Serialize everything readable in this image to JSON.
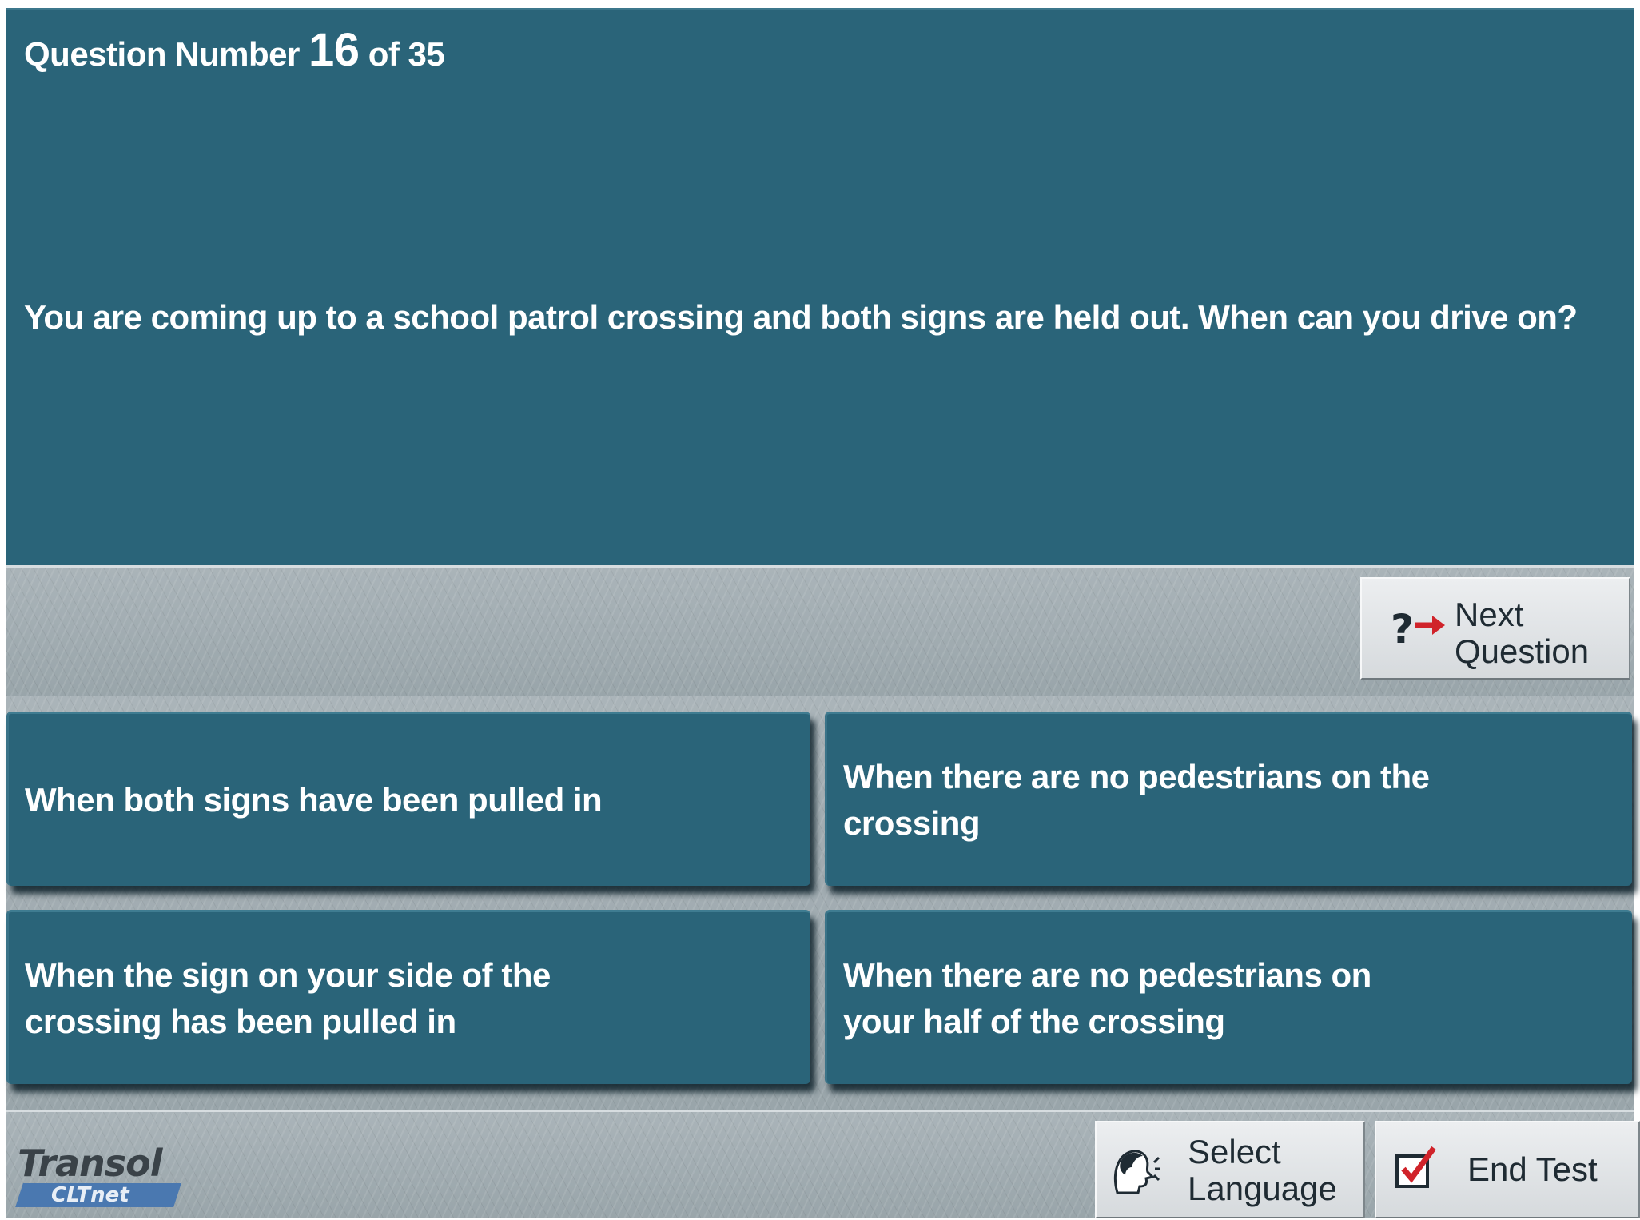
{
  "header": {
    "prefix": "Question Number",
    "current": "16",
    "suffix": "of 35"
  },
  "question": {
    "text": "You are coming up to a school patrol crossing and both signs are held out. When can you drive on?"
  },
  "next_button": {
    "line1": "Next",
    "line2": "Question",
    "icon": "question-arrow-icon"
  },
  "answers": [
    {
      "text": "When both signs have been pulled in"
    },
    {
      "line1": "When there are no pedestrians on the",
      "line2": "crossing"
    },
    {
      "line1": "When the sign on your side of the",
      "line2": "crossing has been pulled in"
    },
    {
      "line1": "When there are no pedestrians on",
      "line2": "your half of the crossing"
    }
  ],
  "footer": {
    "logo": {
      "brand": "Transol",
      "sub": "CLTnet"
    },
    "language_button": {
      "line1": "Select",
      "line2": "Language",
      "icon": "speaking-head-icon"
    },
    "end_button": {
      "label": "End Test",
      "icon": "checkmark-icon"
    }
  },
  "colors": {
    "panel": "#2a6479",
    "background_stone": "#a3aeb3",
    "button_face": "#e2e5e7",
    "arrow_accent": "#d0232a"
  }
}
